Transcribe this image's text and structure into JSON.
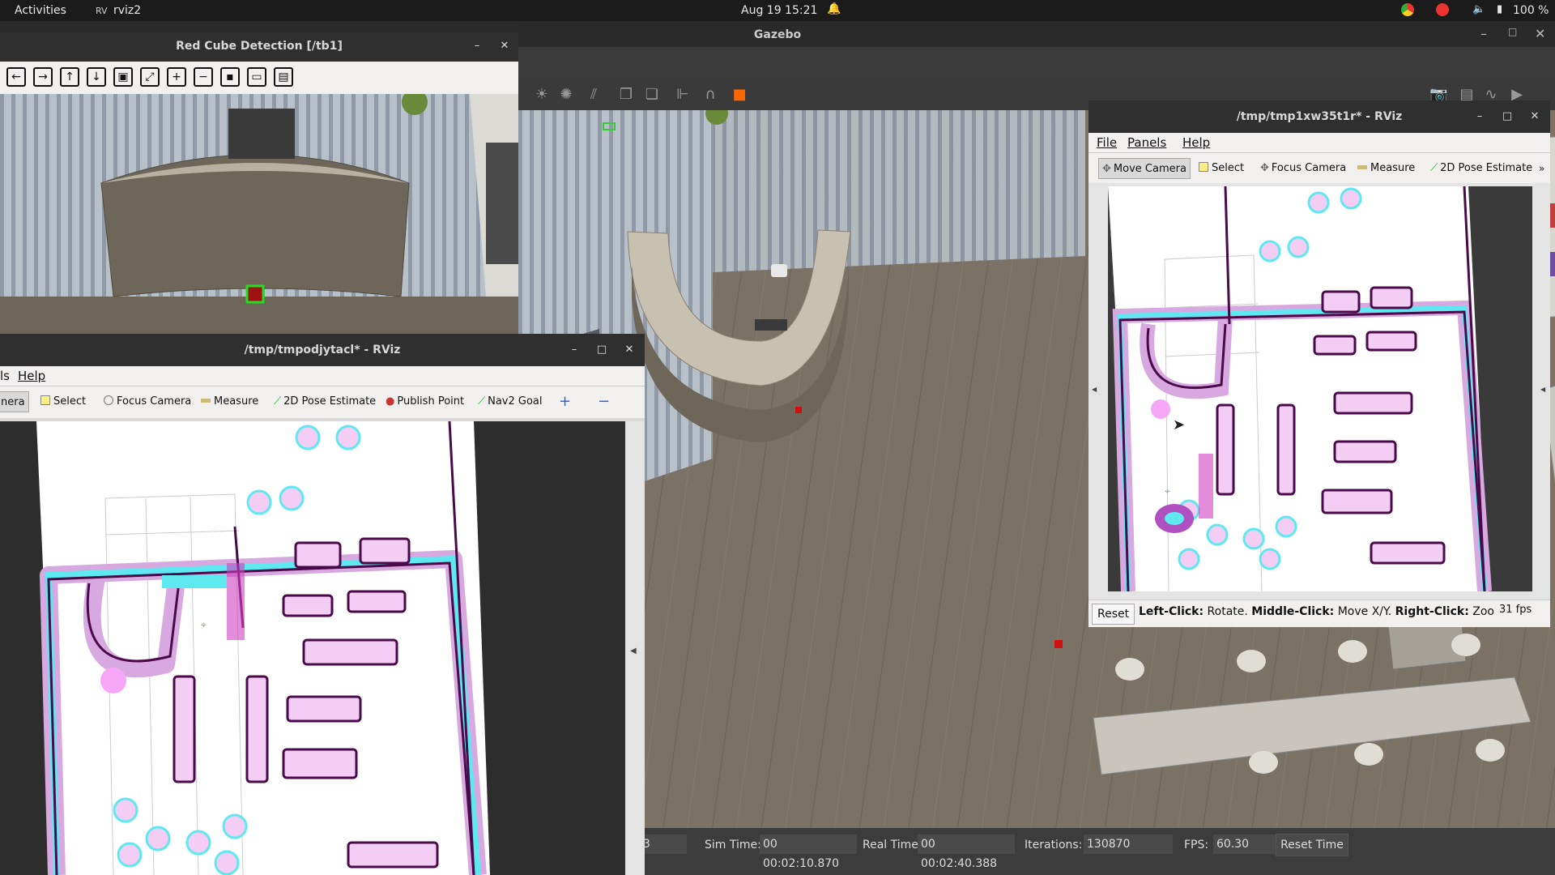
{
  "topbar": {
    "activities": "Activities",
    "app_name": "rviz2",
    "clock": "Aug 19  15:21",
    "battery": "100 %"
  },
  "gazebo": {
    "title": "Gazebo",
    "status": {
      "sim_time_label": "Sim Time:",
      "sim_time": "00 00:02:10.870",
      "real_time_label": "Real Time:",
      "real_time": "00 00:02:40.388",
      "iterations_label": "Iterations:",
      "iterations": "130870",
      "fps_label": "FPS:",
      "fps": "60.30",
      "reset_time": "Reset Time",
      "first_box": "3"
    }
  },
  "cube_window": {
    "title": "Red Cube Detection [/tb1]"
  },
  "rviz_left": {
    "title": "/tmp/tmpodjytacl* - RViz",
    "menu": {
      "partial": "ls",
      "help": "Help"
    },
    "tools": [
      "nera",
      "Select",
      "Focus Camera",
      "Measure",
      "2D Pose Estimate",
      "Publish Point",
      "Nav2 Goal"
    ]
  },
  "rviz_right": {
    "title": "/tmp/tmp1xw35t1r* - RViz",
    "menu": {
      "file": "File",
      "panels": "Panels",
      "help": "Help"
    },
    "tools": [
      "Move Camera",
      "Select",
      "Focus Camera",
      "Measure",
      "2D Pose Estimate"
    ],
    "status": {
      "reset": "Reset",
      "left_click": "Left-Click:",
      "rotate": "Rotate.",
      "middle_click": "Middle-Click:",
      "move": "Move X/Y.",
      "right_click": "Right-Click:",
      "zoom": "Zoom. S",
      "fps": "31 fps"
    }
  }
}
